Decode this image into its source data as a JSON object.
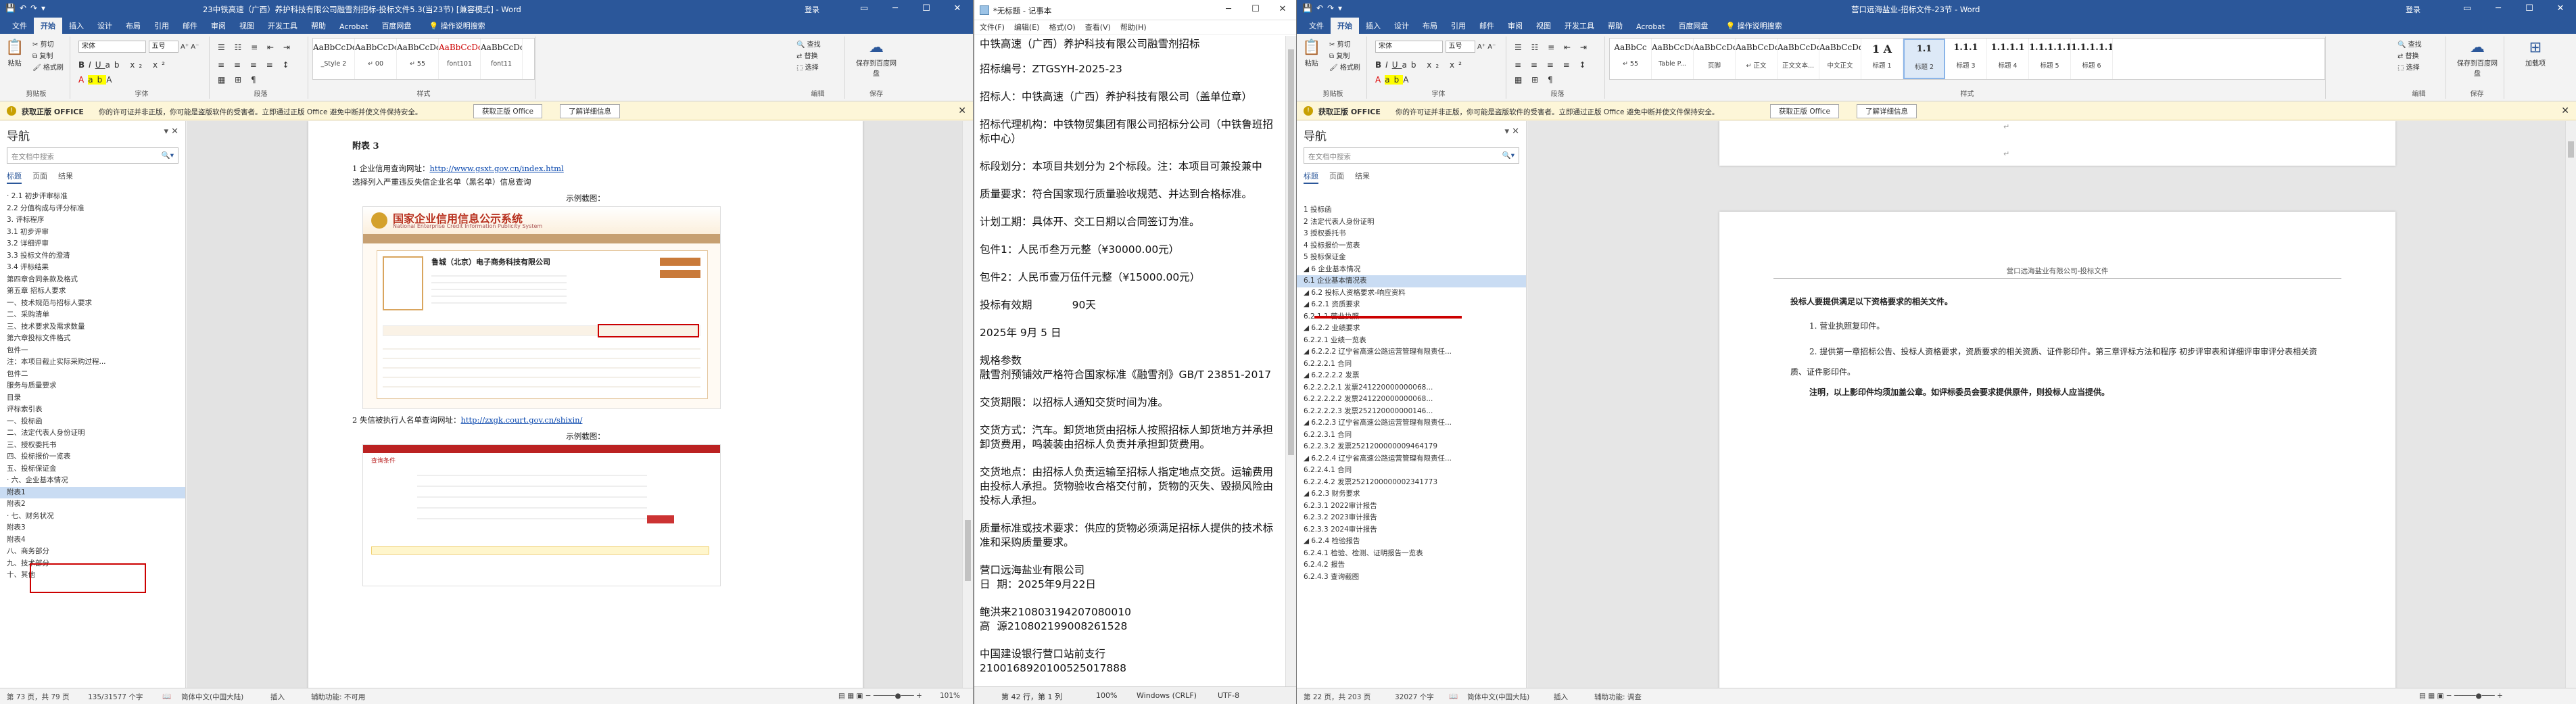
{
  "left_word": {
    "title": "23中铁高速（广西）养护科技有限公司融雪剂招标-投标文件5.3(当23节) [兼容模式] - Word",
    "signin": "登录",
    "tabs": [
      "文件",
      "开始",
      "插入",
      "设计",
      "布局",
      "引用",
      "邮件",
      "审阅",
      "视图",
      "开发工具",
      "帮助",
      "Acrobat",
      "百度网盘"
    ],
    "tell_me": "操作说明搜索",
    "ribbon": {
      "paste": "粘贴",
      "cut": "剪切",
      "copy": "复制",
      "format_painter": "格式刷",
      "clipboard": "剪贴板",
      "font_name": "宋体",
      "font_size": "五号",
      "font_group": "字体",
      "para_group": "段落",
      "styles_group": "样式",
      "styles": [
        {
          "preview": "AaBbCcDd",
          "name": "_Style 2"
        },
        {
          "preview": "AaBbCcDc",
          "name": "↵ 00"
        },
        {
          "preview": "AaBbCcDc",
          "name": "↵ 55"
        },
        {
          "preview": "AaBbCcDc",
          "name": "font101"
        },
        {
          "preview": "AaBbCcDc",
          "name": "font11"
        }
      ],
      "find": "查找",
      "replace": "替换",
      "select": "选择",
      "edit_group": "编辑",
      "save_baidu": "保存到百度网盘",
      "save_group": "保存"
    },
    "msgbar": {
      "badge": "获取正版 OFFICE",
      "text": "你的许可证并非正版，你可能是盗版软件的受害者。立即通过正版 Office 避免中断并使文件保持安全。",
      "btn1": "获取正版 Office",
      "btn2": "了解详细信息"
    },
    "nav": {
      "header": "导航",
      "search_placeholder": "在文档中搜索",
      "tabs": [
        "标题",
        "页面",
        "结果"
      ],
      "items": [
        "· 2.1 初步评审标准",
        "  2.2 分值构成与评分标准",
        "3. 评标程序",
        "  3.1 初步评审",
        "  3.2 详细评审",
        "  3.3 投标文件的澄清",
        "  3.4 评标结果",
        "第四章合同条款及格式",
        "第五章 招标人要求",
        "  一、技术规范与招标人要求",
        "  二、采购清单",
        "  三、技术要求及需求数量",
        "第六章投标文件格式",
        "  包件一",
        "  注：本项目截止实际采购过程...",
        "  包件二",
        "  服务与质量要求",
        "  目录",
        "  评标索引表",
        "  一、投标函",
        "  二、法定代表人身份证明",
        "  三、授权委托书",
        "  四、投标报价一览表",
        "  五、投标保证金",
        "· 六、企业基本情况",
        "    附表1",
        "    附表2",
        "· 七、财务状况",
        "    附表3",
        "    附表4",
        "  八、商务部分",
        "  九、技术部分",
        "  十、其他"
      ]
    },
    "doc": {
      "heading": "附表 3",
      "item1_a": "1 企业信用查询网址：",
      "item1_url": "http://www.gsxt.gov.cn/index.html",
      "item1_b": "选择列入严重违反失信企业名单（黑名单）信息查询",
      "sample": "示例截图：",
      "gsxt_title": "国家企业信用信息公示系统",
      "gsxt_sub": "National Enterprise Credit Information Publicity System",
      "company": "鲁城（北京）电子商务科技有限公司",
      "item2_a": "2 失信被执行人名单查询网址：",
      "item2_url": "http://zxgk.court.gov.cn/shixin/",
      "sample2": "示例截图：",
      "court_query": "查询条件"
    },
    "status": {
      "page": "第 73 页，共 79 页",
      "words": "135/31577 个字",
      "lang": "简体中文(中国大陆)",
      "insert": "插入",
      "access": "辅助功能: 不可用",
      "zoom": "101%"
    }
  },
  "notepad": {
    "title": "*无标题 - 记事本",
    "menu": [
      "文件(F)",
      "编辑(E)",
      "格式(O)",
      "查看(V)",
      "帮助(H)"
    ],
    "lines": [
      "中铁高速（广西）养护科技有限公司融雪剂招标",
      "招标编号：ZTGSYH-2025-23",
      "招标人：中铁高速（广西）养护科技有限公司（盖单位章）",
      "招标代理机构：中铁物贸集团有限公司招标分公司（中铁鲁班招标中心）",
      "标段划分：本项目共划分为 2个标段。注：本项目可兼投兼中",
      "质量要求：符合国家现行质量验收规范、并达到合格标准。",
      "计划工期：具体开、交工日期以合同签订为准。",
      "包件1：人民币叁万元整（¥30000.00元）",
      "包件2：人民币壹万伍仟元整（¥15000.00元）",
      "投标有效期            90天",
      "2025年 9月 5 日",
      "规格参数\n融雪剂预铺效严格符合国家标准《融雪剂》GB/T 23851-2017",
      "交货期限：以招标人通知交货时间为准。",
      "交货方式：汽车。卸货地货由招标人按照招标人卸货地方并承担卸货费用，鸣装装由招标人负责并承担卸货费用。",
      "交货地点：由招标人负责运输至招标人指定地点交货。运输费用由投标人承担。货物验收合格交付前，货物的灭失、毁损风险由投标人承担。",
      "质量标准或技术要求：供应的货物必须满足招标人提供的技术标准和采购质量要求。",
      "营口远海盐业有限公司\n日  期：2025年9月22日",
      "鲍洪来210803194207080010\n高  源210802199008261528",
      "中国建设银行营口站前支行\n2100168920100525017888"
    ],
    "status": {
      "pos": "第 42 行，第 1 列",
      "zoom": "100%",
      "eol": "Windows (CRLF)",
      "enc": "UTF-8"
    }
  },
  "right_word": {
    "title": "营口远海盐业-招标文件-23节 - Word",
    "signin": "登录",
    "tabs": [
      "文件",
      "开始",
      "插入",
      "设计",
      "布局",
      "引用",
      "邮件",
      "审阅",
      "视图",
      "开发工具",
      "帮助",
      "Acrobat",
      "百度网盘"
    ],
    "tell_me": "操作说明搜索",
    "ribbon": {
      "font_name": "宋体",
      "font_size": "五号",
      "styles": [
        {
          "preview": "AaBbCc",
          "name": "↵ 55"
        },
        {
          "preview": "AaBbCcDc",
          "name": "Table P..."
        },
        {
          "preview": "AaBbCcDd",
          "name": "页脚"
        },
        {
          "preview": "AaBbCcDd",
          "name": "↵ 正文"
        },
        {
          "preview": "AaBbCcDd",
          "name": "正文文本..."
        },
        {
          "preview": "AaBbCcDd",
          "name": "中文正文"
        },
        {
          "preview": "1 A",
          "name": "标题 1"
        },
        {
          "preview": "1.1",
          "name": "标题 2"
        },
        {
          "preview": "1.1.1",
          "name": "标题 3"
        },
        {
          "preview": "1.1.1.1",
          "name": "标题 4"
        },
        {
          "preview": "1.1.1.1.1",
          "name": "标题 5"
        },
        {
          "preview": "1.1.1.1.1.1",
          "name": "标题 6"
        }
      ],
      "find": "查找",
      "replace": "替换",
      "select": "选择",
      "save_baidu": "保存到百度网盘",
      "addin": "加载项"
    },
    "msgbar": {
      "badge": "获取正版 OFFICE",
      "text": "你的许可证并非正版，你可能是盗版软件的受害者。立即通过正版 Office 避免中断并使文件保持安全。",
      "btn1": "获取正版 Office",
      "btn2": "了解详细信息"
    },
    "nav": {
      "header": "导航",
      "search_placeholder": "在文档中搜索",
      "tabs": [
        "标题",
        "页面",
        "结果"
      ],
      "items": [
        "  1 投标函",
        "  2 法定代表人身份证明",
        "  3 授权委托书",
        "  4 投标报价一览表",
        "  5 投标保证金",
        "◢ 6 企业基本情况",
        "    6.1 企业基本情况表",
        "  ◢ 6.2 投标人资格要求-响应资料",
        "    ◢ 6.2.1 资质要求",
        "        6.2.1.1 营业执照",
        "    ◢ 6.2.2 业绩要求",
        "        6.2.2.1 业绩一览表",
        "      ◢ 6.2.2.2 辽宁省高速公路运营管理有限责任...",
        "          6.2.2.2.1 合同",
        "        ◢ 6.2.2.2.2 发票",
        "            6.2.2.2.2.1 发票241220000000068...",
        "            6.2.2.2.2.2 发票241220000000068...",
        "            6.2.2.2.2.3 发票252120000000146...",
        "      ◢ 6.2.2.3 辽宁省高速公路运营管理有限责任...",
        "          6.2.2.3.1 合同",
        "          6.2.2.3.2 发票2521200000009464179",
        "      ◢ 6.2.2.4 辽宁省高速公路运营管理有限责任...",
        "          6.2.2.4.1 合同",
        "          6.2.2.4.2 发票2521200000002341773",
        "    ◢ 6.2.3 财务要求",
        "        6.2.3.1 2022审计报告",
        "        6.2.3.2 2023审计报告",
        "        6.2.3.3 2024审计报告",
        "    ◢ 6.2.4 检验报告",
        "        6.2.4.1 检验、检测、证明报告一览表",
        "        6.2.4.2 报告",
        "        6.2.4.3 查询截图"
      ]
    },
    "doc": {
      "header": "营口远海盐业有限公司-投标文件",
      "h1": "投标人要提供满足以下资格要求的相关文件。",
      "p1": "1. 营业执照复印件。",
      "p2": "2. 提供第一章招标公告、投标人资格要求，资质要求的相关资质、证件影印件。第三章评标方法和程序 初步评审表和详细评审审评分表相关资质、证件影印件。",
      "note": "注明，以上影印件均须加盖公章。如评标委员会要求提供原件，则投标人应当提供。"
    },
    "status": {
      "page": "第 22 页，共 203 页",
      "words": "32027 个字",
      "lang": "简体中文(中国大陆)",
      "insert": "插入",
      "access": "辅助功能: 调查"
    }
  }
}
